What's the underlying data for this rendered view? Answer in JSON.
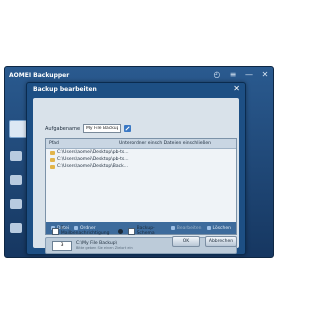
{
  "app": {
    "title": "AOMEI Backupper",
    "controls": [
      "◴",
      "≡",
      "—",
      "✕"
    ]
  },
  "dialog": {
    "title": "Backup bearbeiten",
    "close_icon": "✕",
    "task_label": "Aufgabename",
    "task_value": "My File Backup",
    "list_headers": {
      "path": "Pfad",
      "exclude": "Unterordner einsch Dateien einschließen"
    },
    "files": [
      "C:\\Users\\aomei\\Desktop\\pb-ts...",
      "C:\\Users\\aomei\\Desktop\\pb-ts...",
      "C:\\Users\\aomei\\Desktop\\Back..."
    ],
    "footer": {
      "file": "Datei",
      "folder": "Ordner",
      "edit": "Bearbeiten",
      "delete": "Löschen"
    },
    "destination": {
      "number": "3",
      "path": "C:\\My File Backup\\",
      "sub": "Bitte geben Sie einen Zielort ein"
    },
    "email_label": "E-Mailbenachrichtigung",
    "scheme_label": "Backup-Schema",
    "ok_label": "OK",
    "cancel_label": "Abbrechen"
  }
}
